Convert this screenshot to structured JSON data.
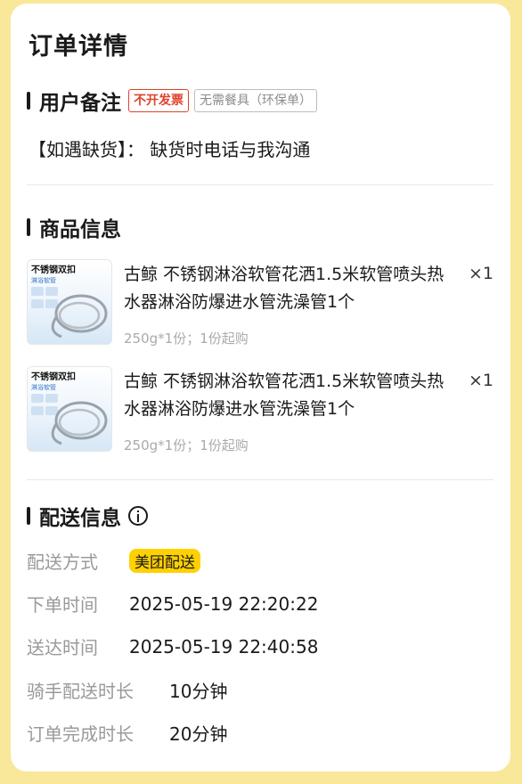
{
  "page_title": "订单详情",
  "user_remark": {
    "heading": "用户备注",
    "tags": [
      "不开发票",
      "无需餐具（环保单）"
    ],
    "remark_text": "【如遇缺货】： 缺货时电话与我沟通"
  },
  "products": {
    "heading": "商品信息",
    "items": [
      {
        "image_title": "不锈钢双扣",
        "image_subtitle": "淋浴软管",
        "name": "古鲸 不锈钢淋浴软管花洒1.5米软管喷头热水器淋浴防爆进水管洗澡管1个",
        "quantity": "×1",
        "spec": "250g*1份；1份起购"
      },
      {
        "image_title": "不锈钢双扣",
        "image_subtitle": "淋浴软管",
        "name": "古鲸 不锈钢淋浴软管花洒1.5米软管喷头热水器淋浴防爆进水管洗澡管1个",
        "quantity": "×1",
        "spec": "250g*1份；1份起购"
      }
    ]
  },
  "delivery": {
    "heading": "配送信息",
    "rows": [
      {
        "label": "配送方式",
        "value": "美团配送"
      },
      {
        "label": "下单时间",
        "value": "2025-05-19 22:20:22"
      },
      {
        "label": "送达时间",
        "value": "2025-05-19 22:40:58"
      },
      {
        "label": "骑手配送时长",
        "value": "10分钟"
      },
      {
        "label": "订单完成时长",
        "value": "20分钟"
      }
    ]
  },
  "colors": {
    "background": "#f9e79a",
    "tag_red": "#e0412b",
    "delivery_badge": "#ffd100"
  }
}
